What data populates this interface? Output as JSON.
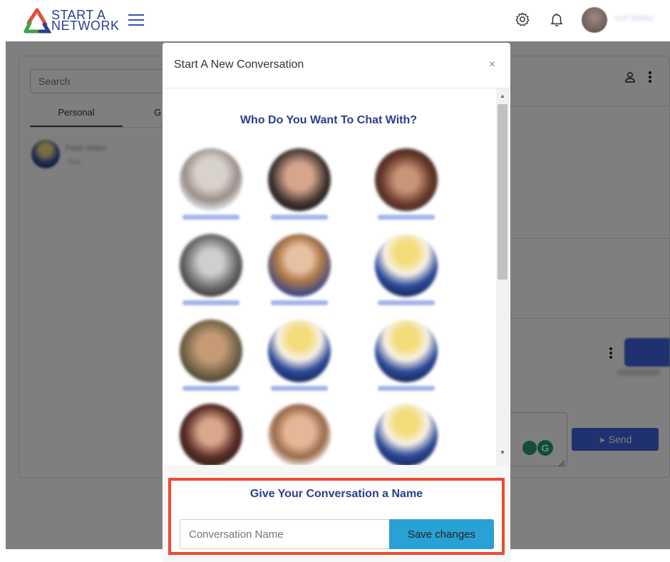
{
  "header": {
    "logo_line1": "START A",
    "logo_line2": "NETWORK",
    "user_name": "Self Skilled",
    "icons": [
      "menu-icon",
      "gear-icon",
      "bell-icon",
      "avatar"
    ]
  },
  "sidebar": {
    "search_placeholder": "Search",
    "tabs": [
      {
        "label": "Personal",
        "active": true
      },
      {
        "label": "G",
        "active": false
      }
    ],
    "conversation": {
      "name": "Peter Adam",
      "subtitle": "Test"
    }
  },
  "composer": {
    "send_label": "Send"
  },
  "modal": {
    "title": "Start A New Conversation",
    "close_label": "×",
    "heading": "Who Do You Want To Chat With?",
    "people": [
      {
        "name": "Rob Mackay"
      },
      {
        "name": "Alex Carrington"
      },
      {
        "name": "Sarah Lane"
      },
      {
        "name": "Dean Baxter"
      },
      {
        "name": "Lisa Emerson"
      },
      {
        "name": "Adrian Gro"
      },
      {
        "name": "Gordon Hudson"
      },
      {
        "name": "Dennis Argo"
      },
      {
        "name": "Paul Bradshaw"
      },
      {
        "name": "Amanda Keys"
      },
      {
        "name": "Kate Morris"
      },
      {
        "name": "Team User"
      }
    ],
    "footer_heading": "Give Your Conversation a Name",
    "name_input_placeholder": "Conversation Name",
    "save_label": "Save changes"
  },
  "colors": {
    "brand_blue": "#2a3f8c",
    "accent_button": "#2aa1d4",
    "highlight_border": "#ee4a2e",
    "send_button": "#3e63dc"
  }
}
